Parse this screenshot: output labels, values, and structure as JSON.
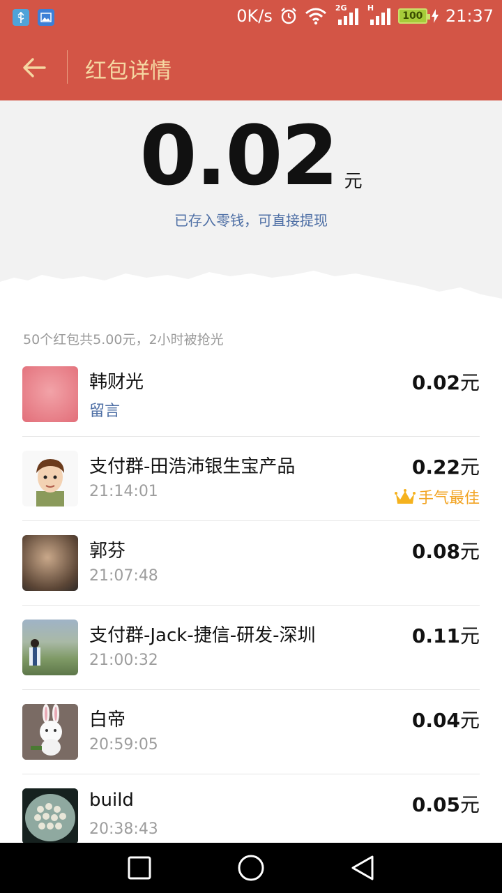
{
  "status_bar": {
    "speed": "0K/s",
    "network_2g": "2G",
    "network_h": "H",
    "battery": "100",
    "time": "21:37"
  },
  "header": {
    "title": "红包详情"
  },
  "amount": {
    "value": "0.02",
    "unit": "元",
    "note": "已存入零钱，可直接提现"
  },
  "summary": "50个红包共5.00元，2小时被抢光",
  "recipients": [
    {
      "name": "韩财光",
      "sub": "留言",
      "amount": "0.02",
      "unit": "元"
    },
    {
      "name": "支付群-田浩沛银生宝产品",
      "sub": "21:14:01",
      "amount": "0.22",
      "unit": "元",
      "badge": "手气最佳"
    },
    {
      "name": "郭芬",
      "sub": "21:07:48",
      "amount": "0.08",
      "unit": "元"
    },
    {
      "name": "支付群-Jack-捷信-研发-深圳",
      "sub": "21:00:32",
      "amount": "0.11",
      "unit": "元"
    },
    {
      "name": "白帝",
      "sub": "20:59:05",
      "amount": "0.04",
      "unit": "元"
    },
    {
      "name": "build",
      "sub": "20:38:43",
      "amount": "0.05",
      "unit": "元"
    }
  ],
  "colors": {
    "brand": "#d35546",
    "title_text": "#f5d7a2",
    "link": "#4e6fa5",
    "best_badge": "#f2a423"
  },
  "icons": {
    "back": "arrow-left-icon",
    "crown": "crown-icon",
    "nav_recent": "square-icon",
    "nav_home": "circle-icon",
    "nav_back": "triangle-back-icon"
  }
}
